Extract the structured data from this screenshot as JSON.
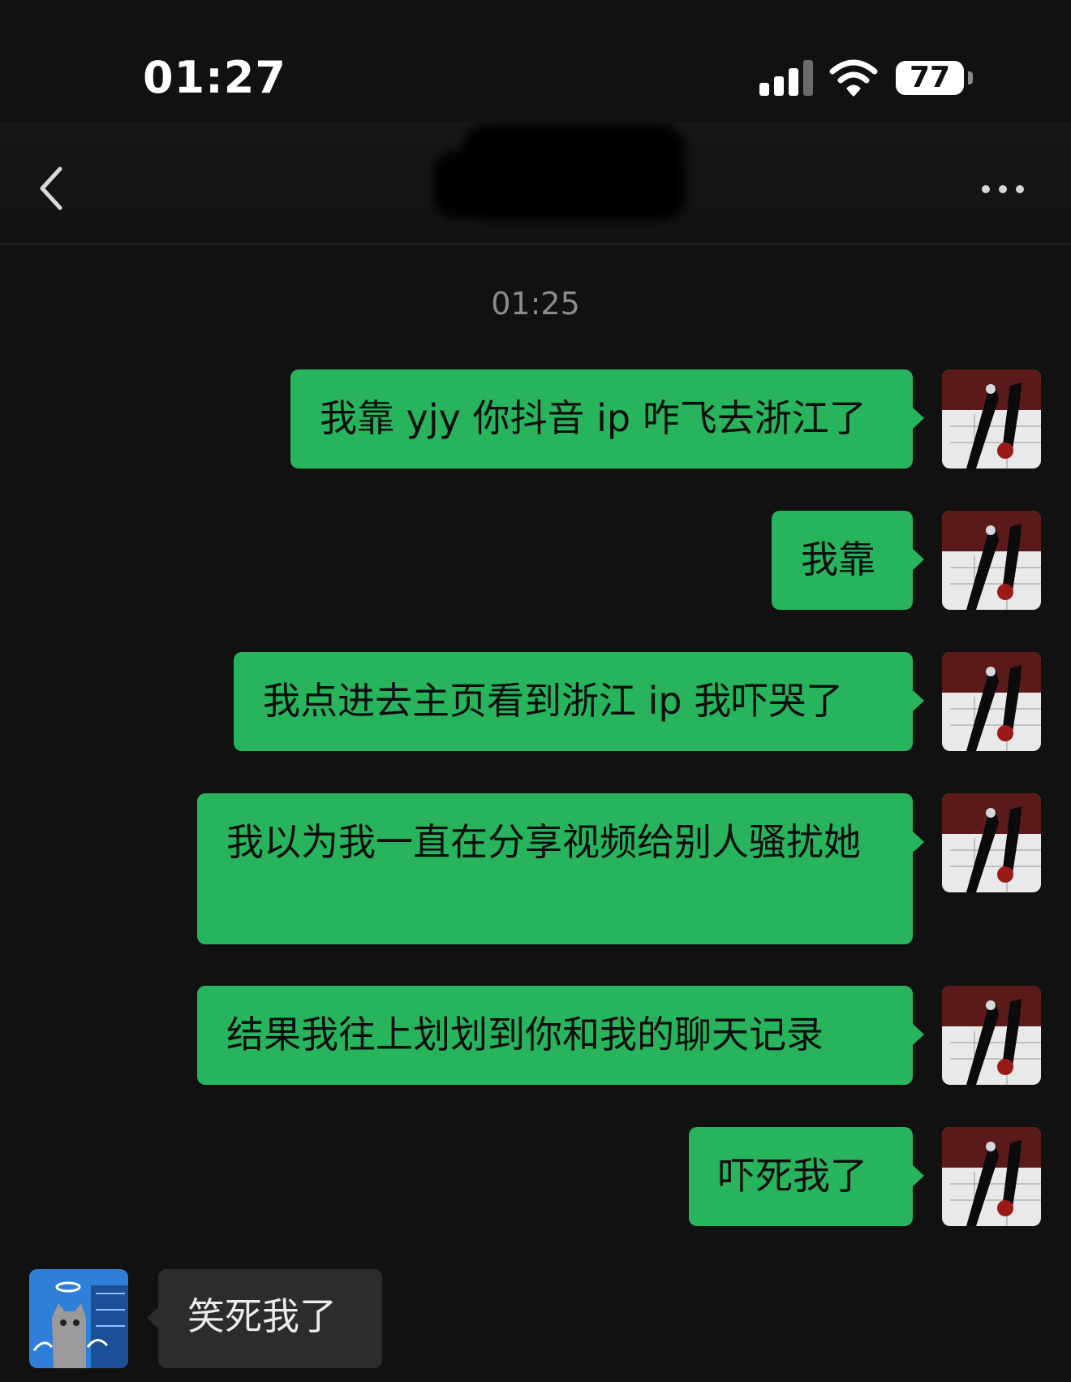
{
  "status_bar": {
    "time": "01:27",
    "battery": "77",
    "signal_icon": "cellular-signal-icon",
    "wifi_icon": "wifi-icon"
  },
  "nav": {
    "back_icon": "chevron-left-icon",
    "more_icon": "ellipsis-icon",
    "title_redacted": true
  },
  "chat": {
    "timestamp": "01:25",
    "messages": [
      {
        "side": "out",
        "text": "我靠 yjy 你抖音 ip 咋飞去浙江了"
      },
      {
        "side": "out",
        "text": "我靠"
      },
      {
        "side": "out",
        "text": "我点进去主页看到浙江 ip 我吓哭了"
      },
      {
        "side": "out",
        "text": "我以为我一直在分享视频给别人骚扰她"
      },
      {
        "side": "out",
        "text": "结果我往上划划到你和我的聊天记录"
      },
      {
        "side": "out",
        "text": "吓死我了"
      },
      {
        "side": "in",
        "text": "笑死我了"
      }
    ]
  },
  "colors": {
    "background": "#111111",
    "outgoing_bubble": "#27b45d",
    "incoming_bubble": "#2c2c2c",
    "timestamp": "#8c8c8c"
  }
}
